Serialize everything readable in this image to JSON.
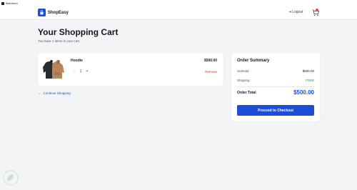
{
  "window": {
    "title": "Mainform"
  },
  "header": {
    "brand": "ShopEasy",
    "logout_label": "Logout",
    "logout_icon": "logout-icon",
    "cart_icon": "cart-icon"
  },
  "cart": {
    "title": "Your Shopping Cart",
    "subtitle": "You have 1 items in your cart."
  },
  "items": [
    {
      "name": "Hoodie",
      "price": "$500.00",
      "quantity": "1",
      "decrement_label": "-",
      "increment_label": "+",
      "remove_label": "Remove"
    }
  ],
  "continue_label": "Continue Shopping",
  "summary": {
    "title": "Order Summary",
    "subtotal_label": "Subtotal",
    "subtotal_value": "$500.00",
    "shipping_label": "Shipping",
    "shipping_value": "FREE",
    "total_label": "Order Total",
    "total_value": "$500.00",
    "checkout_label": "Proceed to Checkout"
  },
  "colors": {
    "accent": "#1d4ed8",
    "remove": "#dc2626",
    "free": "#16a34a",
    "badge": "#ef4444"
  }
}
